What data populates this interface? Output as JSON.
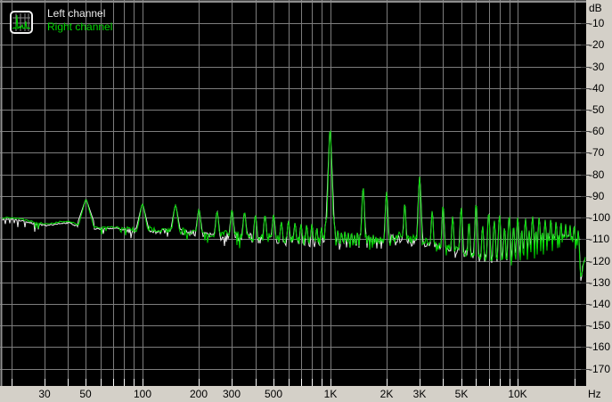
{
  "legend": {
    "left_label": "Left channel",
    "right_label": "Right channel"
  },
  "colors": {
    "background": "#000000",
    "grid": "#7d7d7d",
    "border": "#919191",
    "tick_white": "#ffffff",
    "tick_dark": "#4a4a4a",
    "panel": "#d4d0c8",
    "label_text": "#000000",
    "left_channel": "#ebebeb",
    "right_channel": "#00d800"
  },
  "chart_data": {
    "type": "line",
    "title": "",
    "xlabel": "Hz",
    "ylabel": "dB",
    "axes": {
      "x": {
        "unit": "Hz",
        "scale": "log",
        "min_hz": 17.8,
        "max_hz": 22900,
        "gridline_hz": [
          20,
          30,
          40,
          50,
          60,
          70,
          80,
          90,
          100,
          200,
          300,
          400,
          500,
          600,
          700,
          800,
          900,
          1000,
          2000,
          3000,
          4000,
          5000,
          6000,
          7000,
          8000,
          9000,
          10000,
          20000
        ],
        "tick_labels": [
          {
            "hz": 30,
            "label": "30"
          },
          {
            "hz": 50,
            "label": "50"
          },
          {
            "hz": 100,
            "label": "100"
          },
          {
            "hz": 200,
            "label": "200"
          },
          {
            "hz": 300,
            "label": "300"
          },
          {
            "hz": 500,
            "label": "500"
          },
          {
            "hz": 1000,
            "label": "1K"
          },
          {
            "hz": 2000,
            "label": "2K"
          },
          {
            "hz": 3000,
            "label": "3K"
          },
          {
            "hz": 5000,
            "label": "5K"
          },
          {
            "hz": 10000,
            "label": "10K"
          }
        ]
      },
      "y": {
        "unit": "dB",
        "min_db": -178,
        "max_db": 0,
        "grid_step_db": 10,
        "tick_labels": [
          {
            "db": -10,
            "label": "-10"
          },
          {
            "db": -20,
            "label": "-20"
          },
          {
            "db": -30,
            "label": "-30"
          },
          {
            "db": -40,
            "label": "-40"
          },
          {
            "db": -50,
            "label": "-50"
          },
          {
            "db": -60,
            "label": "-60"
          },
          {
            "db": -70,
            "label": "-70"
          },
          {
            "db": -80,
            "label": "-80"
          },
          {
            "db": -90,
            "label": "-90"
          },
          {
            "db": -100,
            "label": "-100"
          },
          {
            "db": -110,
            "label": "-110"
          },
          {
            "db": -120,
            "label": "-120"
          },
          {
            "db": -130,
            "label": "-130"
          },
          {
            "db": -140,
            "label": "-140"
          },
          {
            "db": -150,
            "label": "-150"
          },
          {
            "db": -160,
            "label": "-160"
          },
          {
            "db": -170,
            "label": "-170"
          }
        ]
      }
    },
    "noise_floor_db": [
      [
        17.8,
        -100.3
      ],
      [
        20,
        -100.0
      ],
      [
        23,
        -100.8
      ],
      [
        27,
        -102.2
      ],
      [
        31,
        -103.0
      ],
      [
        36,
        -102.0
      ],
      [
        41,
        -101.7
      ],
      [
        44,
        -103.0
      ],
      [
        58,
        -104.6
      ],
      [
        70,
        -104.2
      ],
      [
        80,
        -105.0
      ],
      [
        90,
        -105.4
      ],
      [
        110,
        -105.2
      ],
      [
        130,
        -105.6
      ],
      [
        160,
        -106.0
      ],
      [
        200,
        -107.0
      ],
      [
        250,
        -108.0
      ],
      [
        320,
        -108.6
      ],
      [
        400,
        -109.0
      ],
      [
        500,
        -109.6
      ],
      [
        650,
        -110.6
      ],
      [
        800,
        -111.2
      ],
      [
        950,
        -110.6
      ],
      [
        1100,
        -112.0
      ],
      [
        1300,
        -113.0
      ],
      [
        1600,
        -113.6
      ],
      [
        1900,
        -112.6
      ],
      [
        2100,
        -109.6
      ],
      [
        2400,
        -108.6
      ],
      [
        2700,
        -110.0
      ],
      [
        3000,
        -110.6
      ],
      [
        3500,
        -112.0
      ],
      [
        4000,
        -113.0
      ],
      [
        4600,
        -114.6
      ],
      [
        5200,
        -116.0
      ],
      [
        6000,
        -117.6
      ],
      [
        7000,
        -118.8
      ],
      [
        8000,
        -119.8
      ],
      [
        9000,
        -120.6
      ],
      [
        10000,
        -121.0
      ],
      [
        12000,
        -121.8
      ],
      [
        14000,
        -122.4
      ],
      [
        16000,
        -123.0
      ],
      [
        18000,
        -124.0
      ],
      [
        19500,
        -125.0
      ],
      [
        21000,
        -126.2
      ],
      [
        21800,
        -127.0
      ],
      [
        22300,
        -122.0
      ],
      [
        22900,
        -117.5
      ]
    ],
    "peaks_db": [
      [
        50,
        -91.8,
        1.5
      ],
      [
        100,
        -93.8,
        2.2
      ],
      [
        150,
        -94.3,
        3
      ],
      [
        200,
        -96.3,
        4
      ],
      [
        250,
        -97.3,
        5
      ],
      [
        300,
        -96.8,
        5
      ],
      [
        350,
        -98,
        5
      ],
      [
        400,
        -99,
        6
      ],
      [
        450,
        -99.5,
        6
      ],
      [
        500,
        -98.7,
        6
      ],
      [
        550,
        -102,
        7
      ],
      [
        600,
        -101.5,
        7
      ],
      [
        650,
        -102.5,
        7
      ],
      [
        700,
        -103,
        7
      ],
      [
        750,
        -103.5,
        8
      ],
      [
        800,
        -103,
        8
      ],
      [
        850,
        -105,
        8
      ],
      [
        900,
        -104.5,
        8
      ],
      [
        950,
        -101.3,
        9
      ],
      [
        1000,
        -60,
        13
      ],
      [
        1050,
        -101.8,
        9
      ],
      [
        1100,
        -106,
        9
      ],
      [
        1150,
        -107,
        9
      ],
      [
        1200,
        -106.5,
        9
      ],
      [
        1250,
        -107,
        9
      ],
      [
        1300,
        -107.5,
        9
      ],
      [
        1350,
        -108,
        9
      ],
      [
        1400,
        -107,
        10
      ],
      [
        1450,
        -108,
        10
      ],
      [
        1500,
        -86.5,
        12
      ],
      [
        1550,
        -108,
        10
      ],
      [
        1600,
        -108.5,
        10
      ],
      [
        1650,
        -109,
        10
      ],
      [
        1700,
        -108,
        10
      ],
      [
        1750,
        -109,
        10
      ],
      [
        1800,
        -109.5,
        10
      ],
      [
        1850,
        -109,
        10
      ],
      [
        1900,
        -110,
        10
      ],
      [
        1950,
        -109,
        10
      ],
      [
        2000,
        -88,
        12
      ],
      [
        2500,
        -94,
        12
      ],
      [
        3000,
        -81,
        13
      ],
      [
        3500,
        -97,
        12
      ],
      [
        4000,
        -95,
        12
      ],
      [
        4500,
        -99.5,
        12
      ],
      [
        5000,
        -95.5,
        12
      ],
      [
        5500,
        -103,
        12
      ],
      [
        6000,
        -94.5,
        12
      ],
      [
        6500,
        -104,
        12
      ],
      [
        7000,
        -98.5,
        12
      ],
      [
        7500,
        -101.5,
        12
      ],
      [
        8000,
        -99,
        12
      ],
      [
        8500,
        -105,
        12
      ],
      [
        9000,
        -100,
        12
      ],
      [
        9500,
        -105,
        12
      ],
      [
        10000,
        -100,
        12
      ],
      [
        10500,
        -106,
        12
      ],
      [
        11000,
        -100.5,
        12
      ],
      [
        11500,
        -106,
        12
      ],
      [
        12000,
        -99.5,
        12
      ],
      [
        12500,
        -106.5,
        12
      ],
      [
        13000,
        -100,
        12
      ],
      [
        13500,
        -107,
        12
      ],
      [
        14000,
        -101,
        12
      ],
      [
        14500,
        -107,
        12
      ],
      [
        15000,
        -101,
        12
      ],
      [
        15500,
        -107.5,
        12
      ],
      [
        16000,
        -102,
        12
      ],
      [
        16500,
        -108,
        12
      ],
      [
        17000,
        -102.5,
        12
      ],
      [
        17500,
        -108,
        12
      ],
      [
        18000,
        -103,
        12
      ],
      [
        18500,
        -108.5,
        12
      ],
      [
        19000,
        -103.5,
        12
      ],
      [
        19500,
        -109,
        12
      ],
      [
        20000,
        -104,
        12
      ],
      [
        20500,
        -110,
        12
      ],
      [
        21000,
        -106,
        12
      ]
    ],
    "series": [
      {
        "name": "Left channel",
        "color": "#ebebeb",
        "floor_offset_db": -0.7,
        "slope_scale": 0.8,
        "seed": 71
      },
      {
        "name": "Right channel",
        "color": "#00d800",
        "floor_offset_db": 0,
        "slope_scale": 1,
        "seed": 13
      }
    ],
    "legend_position": "top-left",
    "grid": true
  }
}
